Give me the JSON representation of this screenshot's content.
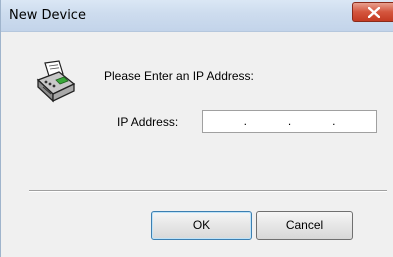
{
  "window": {
    "title": "New Device"
  },
  "icons": {
    "close": "close-icon",
    "device": "printer-fax-icon"
  },
  "dialog": {
    "prompt": "Please Enter an IP Address:",
    "ip_label": "IP Address:",
    "ip_value": "",
    "ip_dots": [
      ".",
      ".",
      "."
    ]
  },
  "buttons": {
    "ok_label": "OK",
    "cancel_label": "Cancel"
  },
  "colors": {
    "close_button": "#c43a22",
    "default_button_border": "#3c7fb1"
  }
}
